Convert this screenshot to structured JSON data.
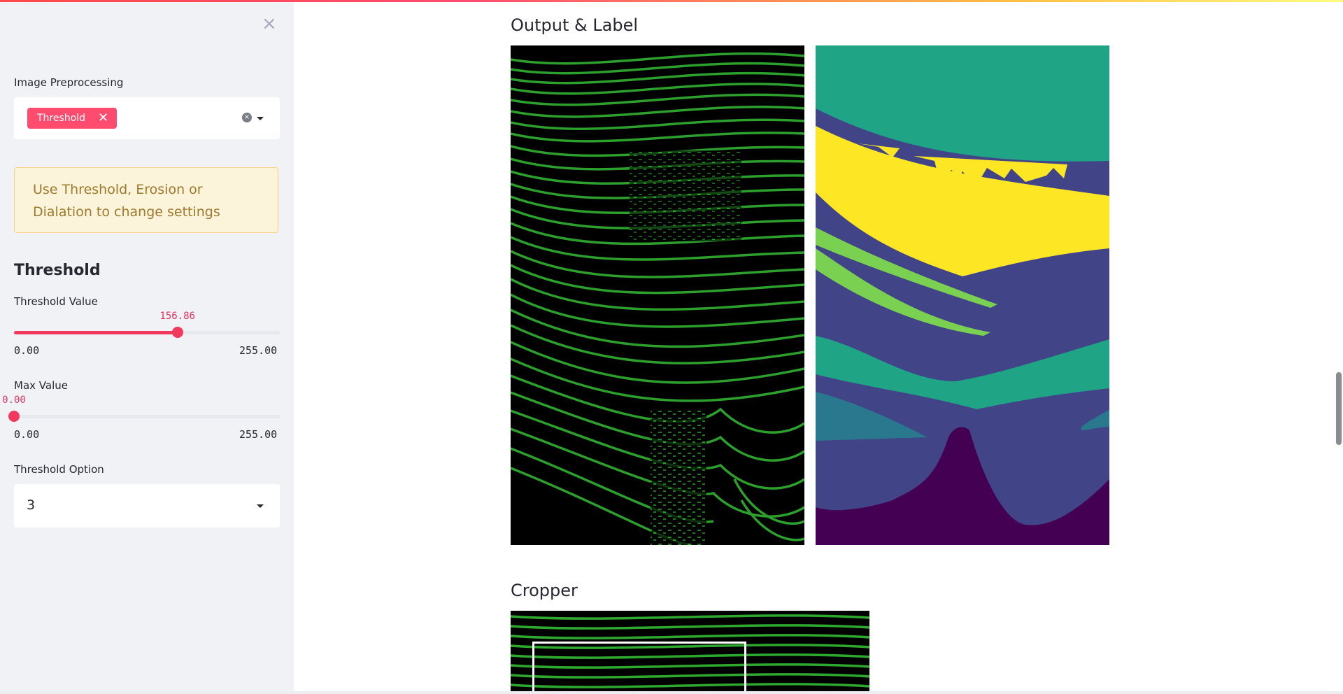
{
  "sidebar": {
    "close_label": "×",
    "preprocessing": {
      "label": "Image Preprocessing",
      "selected_tag": "Threshold",
      "tag_remove": "✕",
      "clear_icon": "×"
    },
    "warning": "Use Threshold, Erosion or Dialation to change settings",
    "section_title": "Threshold",
    "threshold_slider": {
      "label": "Threshold Value",
      "value": "156.86",
      "fraction": 0.615,
      "min_label": "0.00",
      "max_label": "255.00"
    },
    "max_slider": {
      "label": "Max Value",
      "value": "0.00",
      "fraction": 0.0,
      "min_label": "0.00",
      "max_label": "255.00"
    },
    "threshold_option": {
      "label": "Threshold Option",
      "value": "3"
    }
  },
  "main": {
    "output_heading": "Output & Label",
    "cropper_heading": "Cropper"
  },
  "colors": {
    "accent": "#f1395e",
    "seismic_green": "#2fa82f",
    "label_teal": "#20a486",
    "label_yellow": "#fde725",
    "label_indigo": "#414487",
    "label_lime": "#7ad151",
    "label_blue": "#2a788e",
    "label_purple": "#440154"
  }
}
